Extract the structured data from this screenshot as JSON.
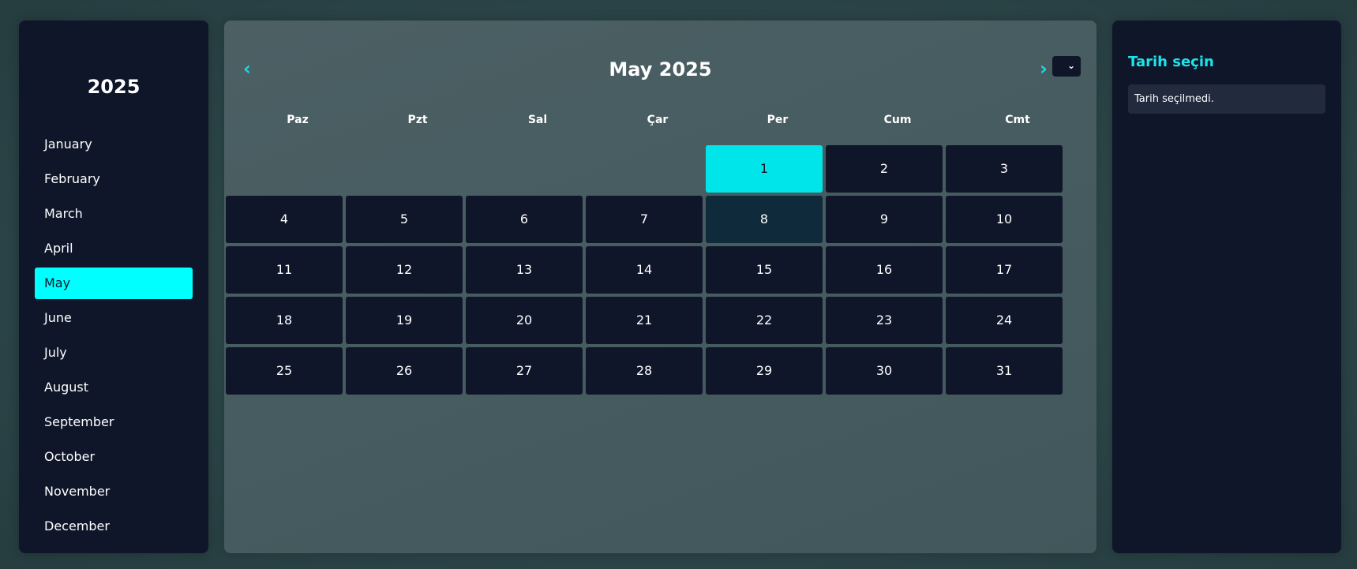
{
  "sidebar": {
    "year": "2025",
    "months": [
      "January",
      "February",
      "March",
      "April",
      "May",
      "June",
      "July",
      "August",
      "September",
      "October",
      "November",
      "December"
    ],
    "active_index": 4
  },
  "calendar": {
    "prev_label": "‹",
    "next_label": "›",
    "title": "May 2025",
    "weekdays": [
      "Paz",
      "Pzt",
      "Sal",
      "Çar",
      "Per",
      "Cum",
      "Cmt"
    ],
    "first_weekday_index": 4,
    "days_in_month": 31,
    "selected_day": 1,
    "today_day": 8
  },
  "details": {
    "title": "Tarih seçin",
    "message": "Tarih seçilmedi."
  },
  "colors": {
    "accent": "#00ffff",
    "panel": "#0f1629",
    "selected_day": "#00e5ea",
    "today_day": "#0e2a3b"
  }
}
